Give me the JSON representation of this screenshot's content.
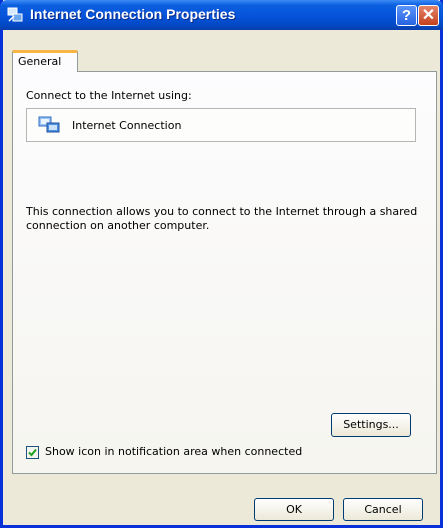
{
  "window": {
    "title": "Internet Connection Properties",
    "help_glyph": "?",
    "close_glyph": "✕"
  },
  "tabs": [
    {
      "label": "General",
      "selected": true
    }
  ],
  "general": {
    "connect_label": "Connect to the Internet using:",
    "connection_name": "Internet Connection",
    "connection_icon": "network-connection-icon",
    "description": "This connection allows you to connect to the Internet through a shared connection on another computer.",
    "settings_label": "Settings...",
    "show_icon_label": "Show icon in notification area when connected",
    "show_icon_checked": true
  },
  "buttons": {
    "ok_label": "OK",
    "cancel_label": "Cancel"
  },
  "colors": {
    "titlebar": "#0553d9",
    "tab_highlight": "#f7b543",
    "dialog_bg": "#ece9d8",
    "check_mark": "#21a121"
  }
}
